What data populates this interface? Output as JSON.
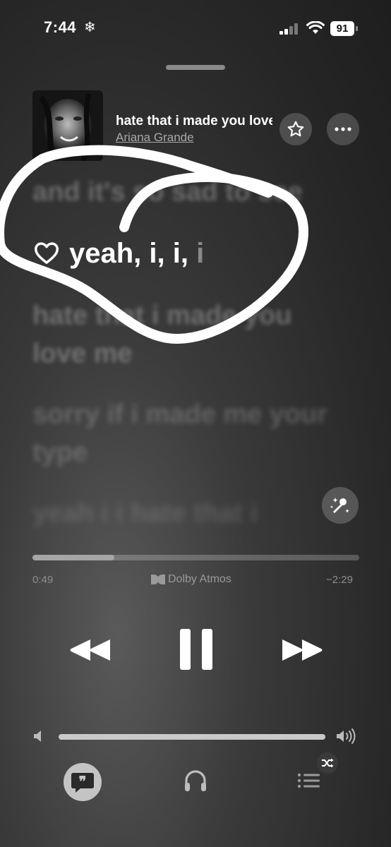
{
  "status_bar": {
    "time": "7:44",
    "focus_icon": "snowflake-icon",
    "battery": "91"
  },
  "now_playing": {
    "title": "hate that i made you love me",
    "artist": "Ariana Grande"
  },
  "lyrics": {
    "previous": "and it's so sad to see",
    "current_sung": "yeah, i, i,",
    "current_unsung": " i",
    "next_1": "hate that i made you love me",
    "next_2": "sorry if i made me your type",
    "next_3": "yeah i i hate that i"
  },
  "playback": {
    "elapsed": "0:49",
    "remaining": "−2:29",
    "progress_fraction": 0.25,
    "audio_format": "Dolby Atmos"
  },
  "volume": {
    "level_fraction": 1.0
  },
  "icons": [
    "snowflake-icon",
    "cellular-signal-icon",
    "wifi-icon",
    "battery-icon",
    "star-icon",
    "more-icon",
    "heart-icon",
    "sing-microphone-icon",
    "dolby-icon",
    "rewind-icon",
    "pause-icon",
    "fast-forward-icon",
    "volume-low-icon",
    "volume-high-icon",
    "lyrics-quote-icon",
    "airplay-audio-icon",
    "queue-list-icon",
    "shuffle-icon"
  ],
  "colors": {
    "annotation_stroke": "#ffffff",
    "progress_fill": "#a5a5a5",
    "lyrics_button_bg": "#c4c4c4"
  }
}
